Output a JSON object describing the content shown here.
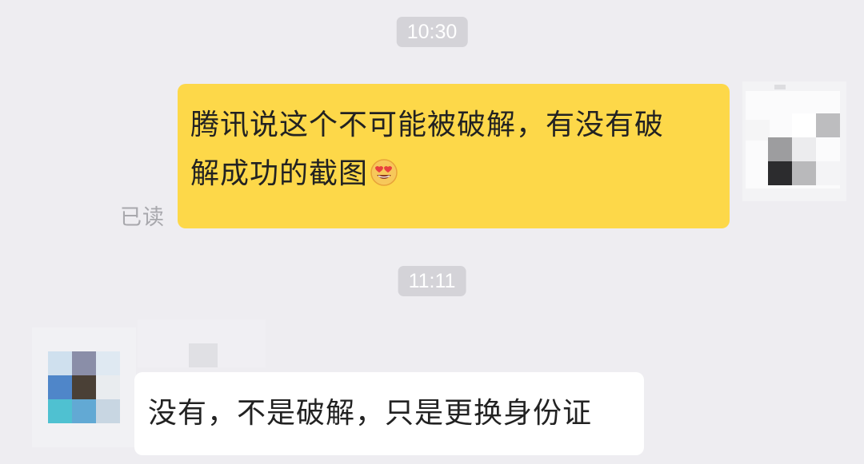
{
  "timestamps": [
    "10:30",
    "11:11"
  ],
  "outgoing_message": {
    "line1": "腾讯说这个不可能被破解，有没有破",
    "line2": "解成功的截图",
    "emoji": "heart-eyes-face-icon",
    "read_status": "已读",
    "bubble_color": "#fdd849"
  },
  "incoming_message": {
    "text": "没有，不是破解，只是更换身份证",
    "bubble_color": "#ffffff"
  },
  "colors": {
    "background": "#eeedf1",
    "timestamp_bg": "#d4d3d8"
  }
}
